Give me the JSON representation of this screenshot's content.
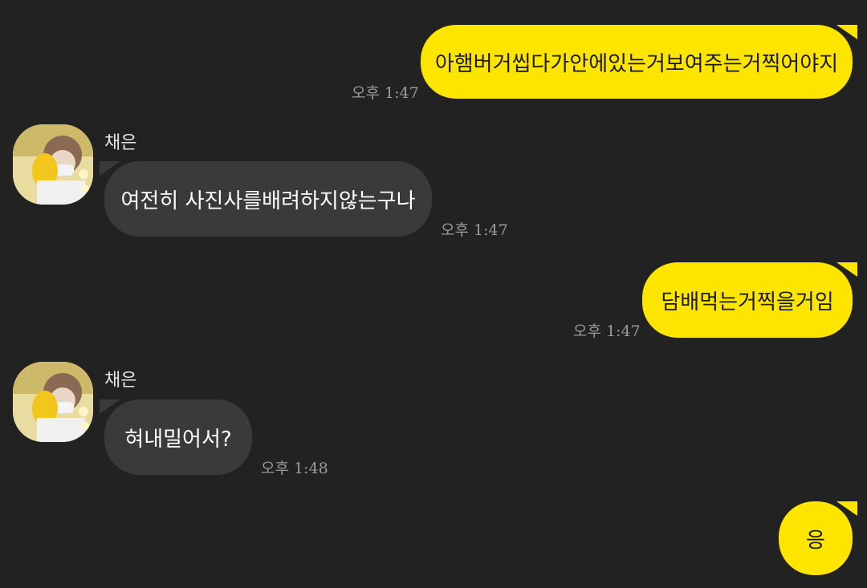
{
  "messages": [
    {
      "direction": "out",
      "text": "아햄버거씹다가안에있는거보여주는거찍어야지",
      "time": "오후 1:47"
    },
    {
      "direction": "in",
      "sender": "채은",
      "text": "여전히 사진사를배려하지않는구나",
      "time": "오후 1:47",
      "avatar_icon": "profile-photo"
    },
    {
      "direction": "out",
      "text": "담배먹는거찍을거임",
      "time": "오후 1:47"
    },
    {
      "direction": "in",
      "sender": "채은",
      "text": "혀내밀어서?",
      "time": "오후 1:48",
      "avatar_icon": "profile-photo"
    },
    {
      "direction": "out",
      "text": "응"
    }
  ],
  "colors": {
    "background": "#222222",
    "outgoing_bubble": "#FEE500",
    "incoming_bubble": "#3a3a3a",
    "timestamp": "#9a9a9a"
  }
}
